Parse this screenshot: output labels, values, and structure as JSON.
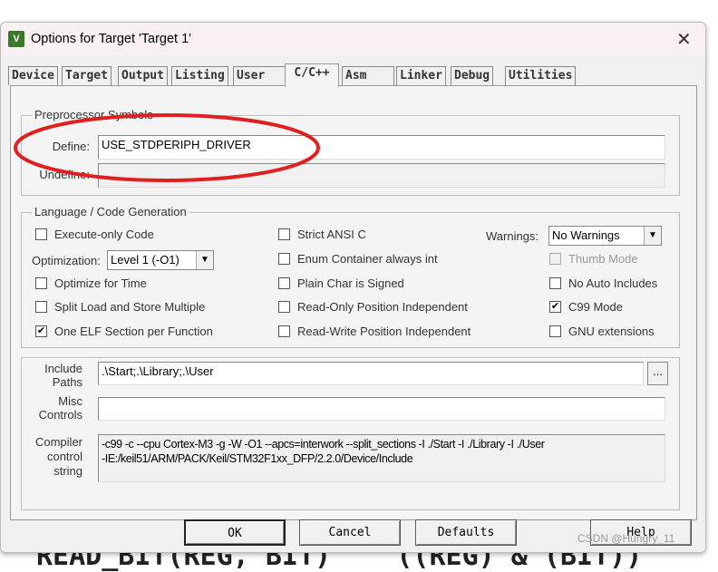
{
  "window": {
    "title": "Options for Target 'Target 1'",
    "icon": "keil-uvision-icon",
    "close": "✕"
  },
  "tabs": [
    "Device",
    "Target",
    "Output",
    "Listing",
    "User",
    "C/C++",
    "Asm",
    "Linker",
    "Debug",
    "Utilities"
  ],
  "active_tab": "C/C++",
  "preprocessor": {
    "group": "Preprocessor Symbols",
    "define_label": "Define:",
    "define_value": "USE_STDPERIPH_DRIVER",
    "undefine_label": "Undefine:",
    "undefine_value": ""
  },
  "language": {
    "group": "Language / Code Generation",
    "execute_only": {
      "label": "Execute-only Code",
      "checked": false
    },
    "optimization_label": "Optimization:",
    "optimization_value": "Level 1 (-O1)",
    "optimize_time": {
      "label": "Optimize for Time",
      "checked": false
    },
    "split_load": {
      "label": "Split Load and Store Multiple",
      "checked": false
    },
    "one_elf": {
      "label": "One ELF Section per Function",
      "checked": true
    },
    "strict_ansi": {
      "label": "Strict ANSI C",
      "checked": false
    },
    "enum_container": {
      "label": "Enum Container always int",
      "checked": false
    },
    "plain_char": {
      "label": "Plain Char is Signed",
      "checked": false
    },
    "ro_pi": {
      "label": "Read-Only Position Independent",
      "checked": false
    },
    "rw_pi": {
      "label": "Read-Write Position Independent",
      "checked": false
    },
    "warnings_label": "Warnings:",
    "warnings_value": "No Warnings",
    "thumb_mode": {
      "label": "Thumb Mode",
      "checked": false,
      "disabled": true
    },
    "no_auto_includes": {
      "label": "No Auto Includes",
      "checked": false
    },
    "c99_mode": {
      "label": "C99 Mode",
      "checked": true
    },
    "gnu_ext": {
      "label": "GNU extensions",
      "checked": false
    }
  },
  "paths": {
    "include_label_1": "Include",
    "include_label_2": "Paths",
    "include_value": ".\\Start;.\\Library;.\\User",
    "browse": "...",
    "misc_label_1": "Misc",
    "misc_label_2": "Controls",
    "misc_value": "",
    "ccs_label_1": "Compiler",
    "ccs_label_2": "control",
    "ccs_label_3": "string",
    "ccs_line1": "-c99 -c --cpu Cortex-M3 -g -W -O1 --apcs=interwork --split_sections -I ./Start -I ./Library -I ./User",
    "ccs_line2": "-IE:/keil51/ARM/PACK/Keil/STM32F1xx_DFP/2.2.0/Device/Include"
  },
  "buttons": {
    "ok": "OK",
    "cancel": "Cancel",
    "defaults": "Defaults",
    "help": "Help"
  },
  "background_text": "READ_BIT(REG, BIT)    ((REG) & (BIT))",
  "watermark": "CSDN @Hungry_11",
  "annotation_color": "#e02020"
}
